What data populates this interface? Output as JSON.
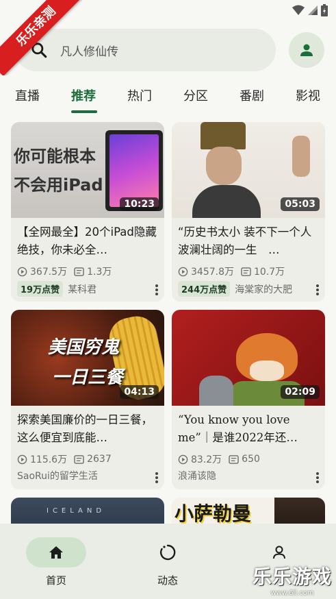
{
  "watermark_ribbon": "乐乐亲测",
  "search": {
    "placeholder": "凡人修仙传"
  },
  "tabs": [
    "直播",
    "推荐",
    "热门",
    "分区",
    "番剧",
    "影视"
  ],
  "active_tab": "推荐",
  "cards": [
    {
      "thumb_text": [
        "你可能根本",
        "不会用iPad"
      ],
      "duration": "10:23",
      "title": "【全网最全】20个iPad隐藏绝技，你未必全…",
      "views": "367.5万",
      "danmaku": "1.3万",
      "badge": "19万点赞",
      "author": "某科君"
    },
    {
      "thumb_text": [],
      "duration": "05:03",
      "title": "“历史书太小 装不下一个人波澜壮阔的一生　…",
      "views": "3457.8万",
      "danmaku": "10.7万",
      "badge": "244万点赞",
      "author": "海棠家的大肥"
    },
    {
      "thumb_text": [
        "美国穷鬼",
        "一日三餐"
      ],
      "duration": "04:13",
      "title": "探索美国廉价的一日三餐，这么便宜到底能…",
      "views": "115.6万",
      "danmaku": "2637",
      "badge": "",
      "author": "SaoRui的留学生活"
    },
    {
      "thumb_text": [],
      "duration": "02:09",
      "title": "“You know you love me”｜是谁2022年还…",
      "views": "83.2万",
      "danmaku": "650",
      "badge": "",
      "author": "浪涌该隐"
    },
    {
      "thumb_text": [
        "ICELAND"
      ],
      "duration": "",
      "title": "",
      "views": "",
      "danmaku": "",
      "badge": "",
      "author": ""
    },
    {
      "thumb_text": [
        "小萨勒曼"
      ],
      "duration": "",
      "title": "",
      "views": "",
      "danmaku": "",
      "badge": "",
      "author": ""
    }
  ],
  "bottom_nav": [
    {
      "label": "首页",
      "icon": "home-icon",
      "active": true
    },
    {
      "label": "动态",
      "icon": "refresh-icon",
      "active": false
    },
    {
      "label": "",
      "icon": "person-icon",
      "active": false
    }
  ],
  "corner_logo": {
    "text": "乐乐游戏",
    "url_text": "www.6ll.com"
  },
  "colors": {
    "accent": "#1b6e3b",
    "background": "#f7f8f3",
    "card": "#eceee7"
  }
}
